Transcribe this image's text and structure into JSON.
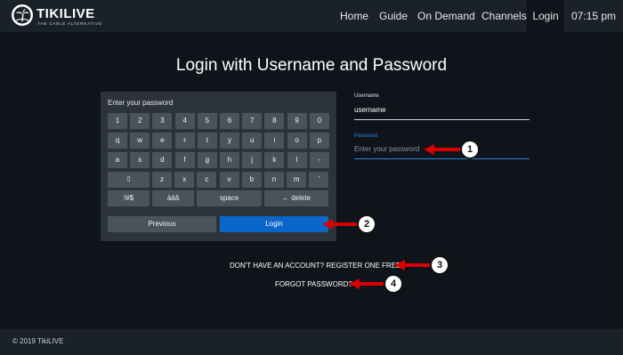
{
  "header": {
    "logo_text": "TIKILIVE",
    "logo_tagline": "THE CABLE ALTERNATIVE",
    "nav": [
      "Home",
      "Guide",
      "On Demand",
      "Channels",
      "Login"
    ],
    "active_nav": "Login",
    "time": "07:15 pm"
  },
  "title": "Login with Username and Password",
  "keyboard": {
    "label": "Enter your password",
    "rows": [
      [
        "1",
        "2",
        "3",
        "4",
        "5",
        "6",
        "7",
        "8",
        "9",
        "0"
      ],
      [
        "q",
        "w",
        "e",
        "r",
        "t",
        "y",
        "u",
        "i",
        "o",
        "p"
      ],
      [
        "a",
        "s",
        "d",
        "f",
        "g",
        "h",
        "j",
        "k",
        "l",
        "-"
      ],
      [
        "⇧",
        "z",
        "x",
        "c",
        "v",
        "b",
        "n",
        "m",
        "'"
      ],
      [
        "!#$",
        "àáâ",
        "space",
        "← delete"
      ]
    ],
    "previous_label": "Previous",
    "login_label": "Login"
  },
  "form": {
    "username_label": "Username",
    "username_value": "username",
    "password_label": "Password",
    "password_placeholder": "Enter your password"
  },
  "links": {
    "register": "DON'T HAVE AN ACCOUNT? REGISTER ONE FREE",
    "forgot": "FORGOT PASSWORD?"
  },
  "callouts": [
    "1",
    "2",
    "3",
    "4"
  ],
  "footer": {
    "copyright": "© 2019 TikiLIVE"
  },
  "colors": {
    "accent": "#0a66c8",
    "arrow": "#d90000",
    "background": "#0f141b",
    "header": "#1b2129"
  }
}
